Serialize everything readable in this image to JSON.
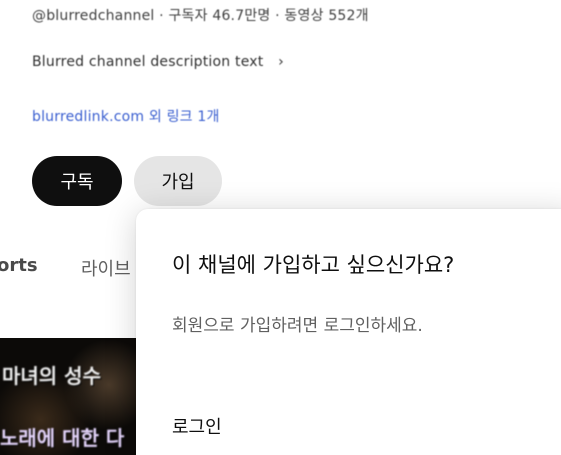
{
  "channel": {
    "handle_line": "@blurredchannel · 구독자 46.7만명 · 동영상 552개",
    "description": "Blurred channel description text",
    "link_text": "blurredlink.com 외 링크 1개"
  },
  "buttons": {
    "subscribe_label": "구독",
    "join_label": "가입"
  },
  "tabs": [
    {
      "label": "orts"
    },
    {
      "label": "라이브"
    }
  ],
  "thumbnail": {
    "line1": "마녀의 성수",
    "line2": "노래에 대한 다"
  },
  "popup": {
    "title": "이 채널에 가입하고 싶으신가요?",
    "subtitle": "회원으로 가입하려면 로그인하세요.",
    "login_label": "로그인"
  },
  "icons": {
    "chevron": "chevron-right-icon"
  }
}
